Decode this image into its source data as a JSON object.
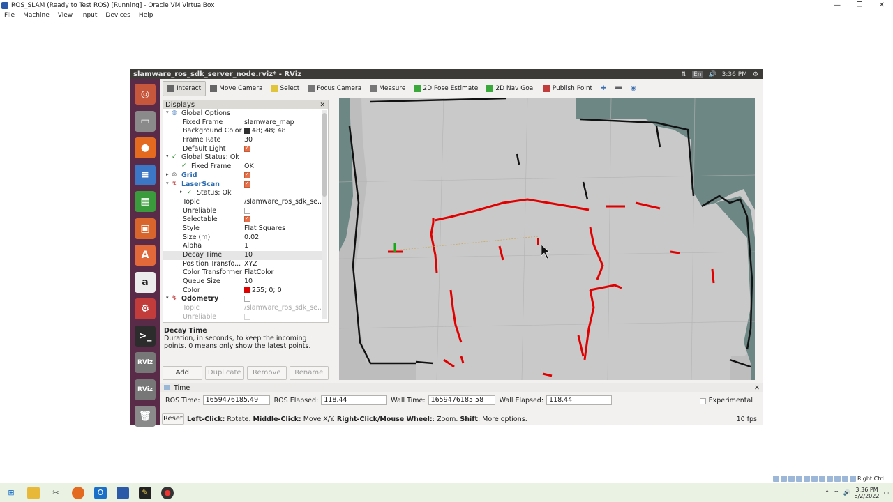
{
  "host_window": {
    "title": "ROS_SLAM (Ready to Test ROS) [Running] - Oracle VM VirtualBox",
    "menu": [
      "File",
      "Machine",
      "View",
      "Input",
      "Devices",
      "Help"
    ],
    "controls": [
      "—",
      "❐",
      "✕"
    ],
    "host_key": "Right Ctrl"
  },
  "guest_topbar": {
    "window_title": "slamware_ros_sdk_server_node.rviz* - RViz",
    "lang": "En",
    "clock": "3:36 PM"
  },
  "launcher": [
    {
      "icon": "ubuntu-logo-icon",
      "glyph": "◎",
      "color": "#c7573c"
    },
    {
      "icon": "files-icon",
      "glyph": "▭",
      "color": "#8a8a8a"
    },
    {
      "icon": "firefox-icon",
      "glyph": "●",
      "color": "#e46a1f"
    },
    {
      "icon": "writer-icon",
      "glyph": "≡",
      "color": "#3b77c4"
    },
    {
      "icon": "calc-icon",
      "glyph": "▦",
      "color": "#3a9b3c"
    },
    {
      "icon": "impress-icon",
      "glyph": "▣",
      "color": "#d8652c"
    },
    {
      "icon": "software-center-icon",
      "glyph": "A",
      "color": "#e2693a"
    },
    {
      "icon": "amazon-icon",
      "glyph": "a",
      "color": "#ececec"
    },
    {
      "icon": "settings-icon",
      "glyph": "⚙",
      "color": "#c23c3c"
    },
    {
      "icon": "terminal-icon",
      "glyph": ">_",
      "color": "#2c2c2c"
    },
    {
      "icon": "rviz-icon",
      "glyph": "RViz",
      "color": "#777777"
    },
    {
      "icon": "rviz-icon-2",
      "glyph": "RViz",
      "color": "#777777"
    },
    {
      "icon": "trash-icon",
      "glyph": "🗑",
      "color": "#8a8a8a"
    }
  ],
  "toolbar": [
    {
      "name": "interact",
      "label": "Interact",
      "active": true,
      "icon_color": "#666"
    },
    {
      "name": "move-camera",
      "label": "Move Camera",
      "active": false,
      "icon_color": "#666"
    },
    {
      "name": "select",
      "label": "Select",
      "active": false,
      "icon_color": "#e0c43a"
    },
    {
      "name": "focus-camera",
      "label": "Focus Camera",
      "active": false,
      "icon_color": "#777"
    },
    {
      "name": "measure",
      "label": "Measure",
      "active": false,
      "icon_color": "#777"
    },
    {
      "name": "2d-pose-estimate",
      "label": "2D Pose Estimate",
      "active": false,
      "icon_color": "#3aa83a"
    },
    {
      "name": "2d-nav-goal",
      "label": "2D Nav Goal",
      "active": false,
      "icon_color": "#3aa83a"
    },
    {
      "name": "publish-point",
      "label": "Publish Point",
      "active": false,
      "icon_color": "#c23c3c"
    }
  ],
  "displays": {
    "title": "Displays",
    "rows": [
      {
        "indent": 0,
        "arrow": "▾",
        "icon": "globe",
        "key": "Global Options",
        "value": "",
        "kcolor": "#222"
      },
      {
        "indent": 1,
        "key": "Fixed Frame",
        "value": "slamware_map"
      },
      {
        "indent": 1,
        "key": "Background Color",
        "value": "48; 48; 48",
        "swatch": "#303030"
      },
      {
        "indent": 1,
        "key": "Frame Rate",
        "value": "30"
      },
      {
        "indent": 1,
        "key": "Default Light",
        "checkbox": true
      },
      {
        "indent": 0,
        "arrow": "▾",
        "icon": "check",
        "key": "Global Status: Ok",
        "value": ""
      },
      {
        "indent": 1,
        "icon": "check",
        "key": "Fixed Frame",
        "value": "OK"
      },
      {
        "indent": 0,
        "arrow": "▸",
        "icon": "grid",
        "key": "Grid",
        "checkbox": true,
        "kcolor": "#2b6cb0",
        "bold": true
      },
      {
        "indent": 0,
        "arrow": "▾",
        "icon": "laser",
        "key": "LaserScan",
        "checkbox": true,
        "kcolor": "#2b6cb0",
        "bold": true
      },
      {
        "indent": 1,
        "arrow": "▸",
        "icon": "check",
        "key": "Status: Ok",
        "value": ""
      },
      {
        "indent": 1,
        "key": "Topic",
        "value": "/slamware_ros_sdk_se..."
      },
      {
        "indent": 1,
        "key": "Unreliable",
        "checkbox": false
      },
      {
        "indent": 1,
        "key": "Selectable",
        "checkbox": true
      },
      {
        "indent": 1,
        "key": "Style",
        "value": "Flat Squares"
      },
      {
        "indent": 1,
        "key": "Size (m)",
        "value": "0.02"
      },
      {
        "indent": 1,
        "key": "Alpha",
        "value": "1"
      },
      {
        "indent": 1,
        "key": "Decay Time",
        "value": "10",
        "selected": true
      },
      {
        "indent": 1,
        "key": "Position Transfo...",
        "value": "XYZ"
      },
      {
        "indent": 1,
        "key": "Color Transformer",
        "value": "FlatColor"
      },
      {
        "indent": 1,
        "key": "Queue Size",
        "value": "10"
      },
      {
        "indent": 1,
        "key": "Color",
        "value": "255; 0; 0",
        "swatch": "#e00000"
      },
      {
        "indent": 0,
        "arrow": "▾",
        "icon": "odom",
        "key": "Odometry",
        "checkbox": false,
        "bold": true
      },
      {
        "indent": 1,
        "key": "Topic",
        "value": "/slamware_ros_sdk_se...",
        "dim": true
      },
      {
        "indent": 1,
        "key": "Unreliable",
        "checkbox": false,
        "dim": true
      }
    ]
  },
  "description": {
    "title": "Decay Time",
    "text": "Duration, in seconds, to keep the incoming points. 0 means only show the latest points."
  },
  "display_buttons": {
    "add": "Add",
    "duplicate": "Duplicate",
    "remove": "Remove",
    "rename": "Rename"
  },
  "time_panel": {
    "title": "Time",
    "ros_time_label": "ROS Time:",
    "ros_time": "1659476185.49",
    "ros_elapsed_label": "ROS Elapsed:",
    "ros_elapsed": "118.44",
    "wall_time_label": "Wall Time:",
    "wall_time": "1659476185.58",
    "wall_elapsed_label": "Wall Elapsed:",
    "wall_elapsed": "118.44",
    "experimental": "Experimental"
  },
  "status_bar": {
    "reset": "Reset",
    "help_parts": [
      {
        "b": "Left-Click:",
        "t": " Rotate. "
      },
      {
        "b": "Middle-Click:",
        "t": " Move X/Y. "
      },
      {
        "b": "Right-Click/Mouse Wheel:",
        "t": ": Zoom. "
      },
      {
        "b": "Shift",
        "t": ": More options."
      }
    ],
    "fps": "10 fps"
  },
  "taskbar": {
    "clock_time": "3:36 PM",
    "clock_date": "8/2/2022"
  }
}
